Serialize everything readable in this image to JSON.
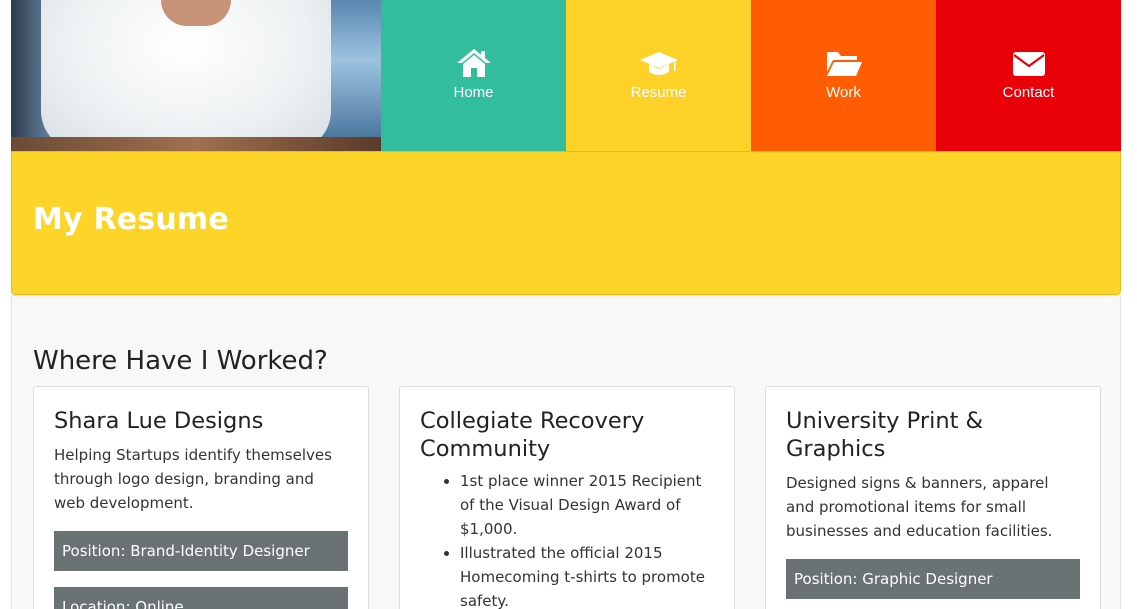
{
  "nav": {
    "items": [
      {
        "label": "Home",
        "icon": "home-icon"
      },
      {
        "label": "Resume",
        "icon": "graduation-cap-icon"
      },
      {
        "label": "Work",
        "icon": "folder-open-icon"
      },
      {
        "label": "Contact",
        "icon": "envelope-icon"
      }
    ]
  },
  "colors": {
    "home": "#32bd9c",
    "resume": "#fdd128",
    "work": "#ff5c03",
    "contact": "#ea0008"
  },
  "banner": {
    "title": "My Resume"
  },
  "section": {
    "heading": "Where Have I Worked?"
  },
  "cards": [
    {
      "title": "Shara Lue Designs",
      "description": "Helping Startups identify themselves through logo design, branding and web development.",
      "position": "Position: Brand-Identity Designer",
      "location": "Location: Online"
    },
    {
      "title": "Collegiate Recovery Community",
      "bullets": [
        "1st place winner 2015 Recipient of the Visual Design Award of $1,000.",
        "Illustrated the official 2015 Homecoming t-shirts to promote safety."
      ]
    },
    {
      "title": "University Print & Graphics",
      "description": "Designed signs & banners, apparel and promotional items for small businesses and education facilities.",
      "position": "Position: Graphic Designer"
    }
  ]
}
